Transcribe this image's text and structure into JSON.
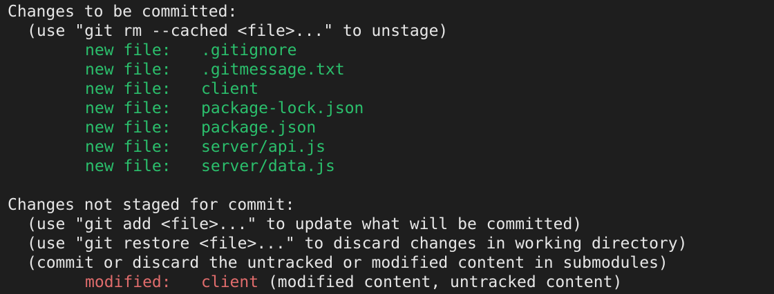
{
  "staged": {
    "header": "Changes to be committed:",
    "hint": "(use \"git rm --cached <file>...\" to unstage)",
    "entries": [
      {
        "status": "new file:",
        "path": ".gitignore"
      },
      {
        "status": "new file:",
        "path": ".gitmessage.txt"
      },
      {
        "status": "new file:",
        "path": "client"
      },
      {
        "status": "new file:",
        "path": "package-lock.json"
      },
      {
        "status": "new file:",
        "path": "package.json"
      },
      {
        "status": "new file:",
        "path": "server/api.js"
      },
      {
        "status": "new file:",
        "path": "server/data.js"
      }
    ]
  },
  "unstaged": {
    "header": "Changes not staged for commit:",
    "hints": [
      "(use \"git add <file>...\" to update what will be committed)",
      "(use \"git restore <file>...\" to discard changes in working directory)",
      "(commit or discard the untracked or modified content in submodules)"
    ],
    "entries": [
      {
        "status": "modified:",
        "path": "client",
        "detail": " (modified content, untracked content)"
      }
    ]
  },
  "colors": {
    "background": "#1e1e1e",
    "text": "#e6e6e6",
    "staged": "#2bbf6c",
    "modified": "#e06c6c"
  }
}
